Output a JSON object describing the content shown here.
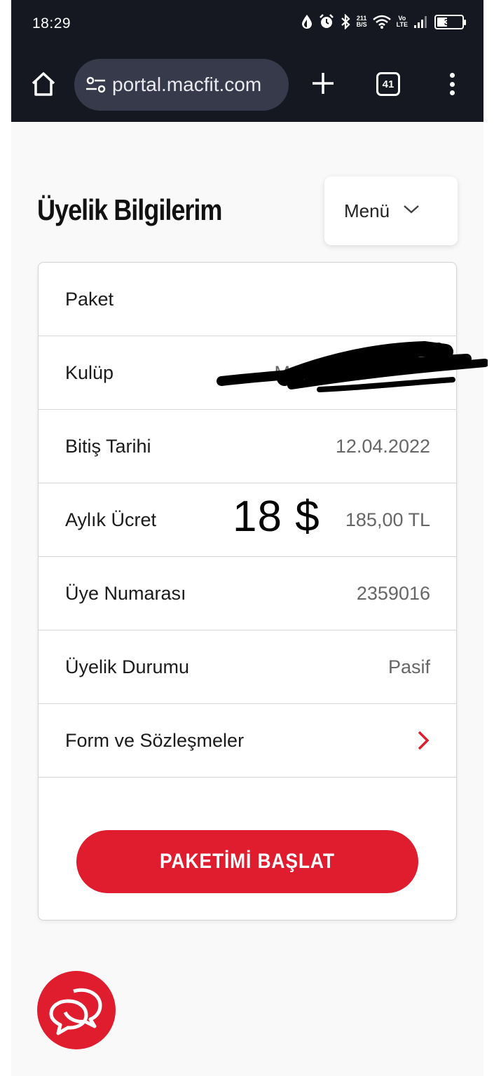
{
  "status_bar": {
    "time": "18:29",
    "data_speed_value": "211",
    "data_speed_unit": "B/S",
    "volte_top": "Vo",
    "volte_bottom": "LTE",
    "battery_level": "38"
  },
  "browser": {
    "url_text": "portal.macfit.com",
    "tab_count": "41"
  },
  "page": {
    "title": "Üyelik Bilgilerim",
    "menu_label": "Menü",
    "rows": [
      {
        "label": "Paket",
        "value": ""
      },
      {
        "label": "Kulüp",
        "value": "M"
      },
      {
        "label": "Bitiş Tarihi",
        "value": "12.04.2022"
      },
      {
        "label": "Aylık Ücret",
        "value": "185,00 TL"
      },
      {
        "label": "Üye Numarası",
        "value": "2359016"
      },
      {
        "label": "Üyelik Durumu",
        "value": "Pasif"
      },
      {
        "label": "Form ve Sözleşmeler",
        "value": ""
      }
    ],
    "overlay_annotation": "18 $",
    "cta_label": "PAKETİMİ BAŞLAT"
  },
  "colors": {
    "brand_red": "#e01d2f",
    "chrome_dark": "#161821",
    "url_pill": "#363a4a"
  },
  "icons": [
    "drop-icon",
    "alarm-icon",
    "bluetooth-icon",
    "wifi-icon",
    "signal-icon",
    "battery-icon",
    "home-icon",
    "tune-icon",
    "plus-icon",
    "tabs-icon",
    "more-vert-icon",
    "chevron-down-icon",
    "chevron-right-icon",
    "chat-icon"
  ]
}
